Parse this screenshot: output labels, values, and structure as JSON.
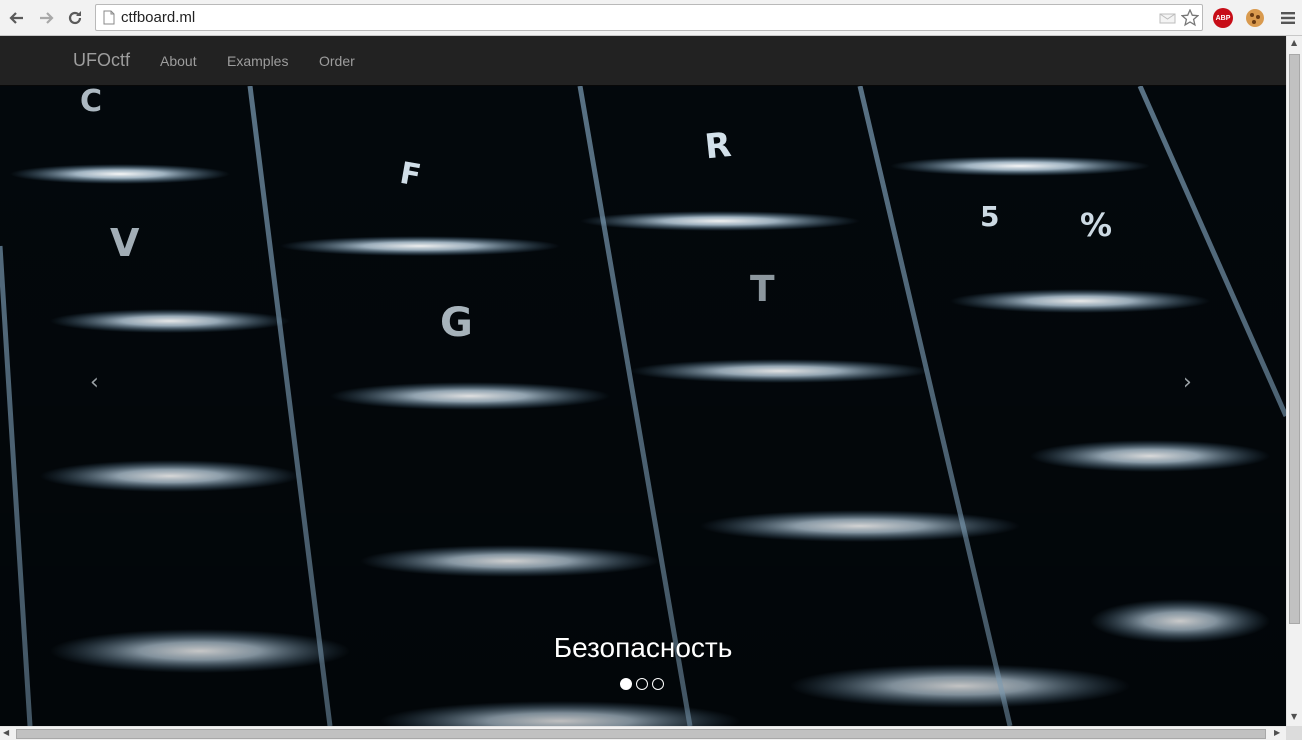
{
  "browser": {
    "url": "ctfboard.ml",
    "abp_label": "ABP"
  },
  "navbar": {
    "brand": "UFOctf",
    "links": [
      "About",
      "Examples",
      "Order"
    ]
  },
  "carousel": {
    "caption": "Безопасность",
    "prev_glyph": "‹",
    "next_glyph": "›",
    "slide_count": 3,
    "active_slide": 1
  },
  "icons": {
    "back": "back-arrow-icon",
    "forward": "forward-arrow-icon",
    "reload": "reload-icon",
    "page": "page-icon",
    "mail": "mail-icon",
    "star": "bookmark-star-icon",
    "adblock": "adblock-icon",
    "cookie": "cookie-icon",
    "menu": "hamburger-menu-icon"
  },
  "colors": {
    "navbar_bg": "#222222",
    "nav_text": "#9d9d9d",
    "abp_red": "#c70d17"
  }
}
